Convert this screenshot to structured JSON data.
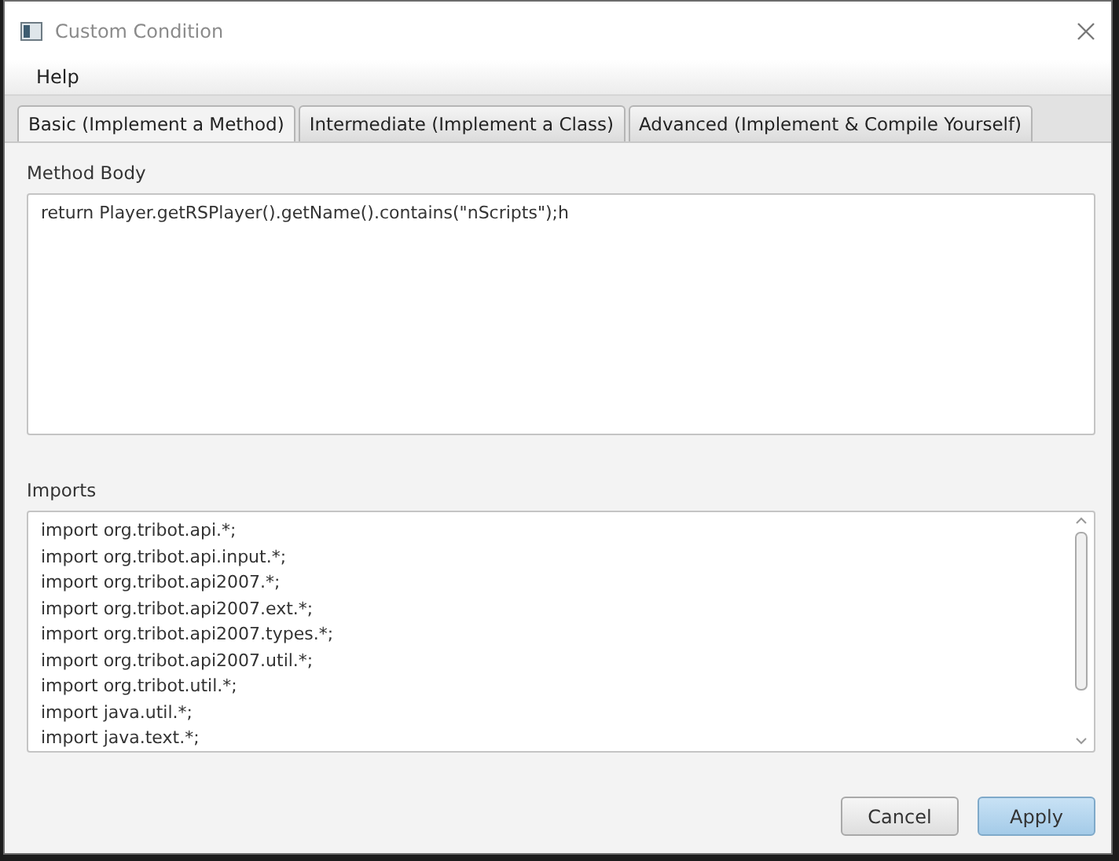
{
  "window": {
    "title": "Custom Condition"
  },
  "menu": [
    "Help"
  ],
  "tabs": [
    {
      "label": "Basic (Implement a Method)",
      "selected": true
    },
    {
      "label": "Intermediate (Implement a Class)",
      "selected": false
    },
    {
      "label": "Advanced (Implement & Compile Yourself)",
      "selected": false
    }
  ],
  "method_body": {
    "label": "Method Body",
    "value": "return Player.getRSPlayer().getName().contains(\"nScripts\");h"
  },
  "imports": {
    "label": "Imports",
    "lines": [
      "import org.tribot.api.*;",
      "import org.tribot.api.input.*;",
      "import org.tribot.api2007.*;",
      "import org.tribot.api2007.ext.*;",
      "import org.tribot.api2007.types.*;",
      "import org.tribot.api2007.util.*;",
      "import org.tribot.util.*;",
      "import java.util.*;",
      "import java.text.*;"
    ]
  },
  "buttons": [
    {
      "label": "Cancel",
      "default": false
    },
    {
      "label": "Apply",
      "default": true
    }
  ]
}
